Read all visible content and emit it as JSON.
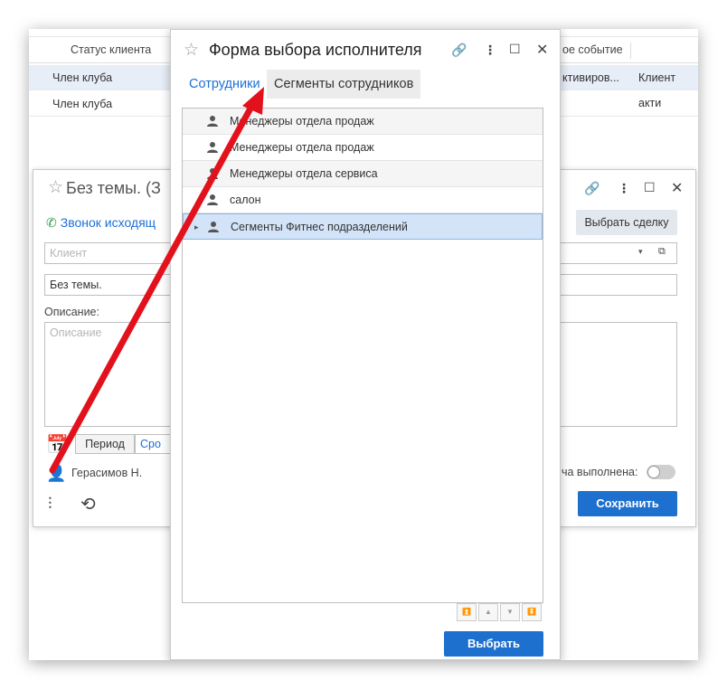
{
  "background_list": {
    "header": {
      "status_col": "Статус клиента",
      "event_col": "ое событие"
    },
    "rows": [
      {
        "status": "Член клуба",
        "event": "ктивиров...",
        "extra": "Клиент акти"
      },
      {
        "status": "Член клуба",
        "event": "",
        "extra": ""
      }
    ]
  },
  "task_form": {
    "title": "Без темы. (З",
    "call_link": "Звонок исходящ",
    "client_placeholder": "Клиент",
    "subject_value": "Без темы.",
    "description_label": "Описание:",
    "description_placeholder": "Описание",
    "period_button": "Период",
    "srok_tab": "Сро",
    "assignee": "Герасимов Н.",
    "done_label": "ча выполнена:",
    "select_deal_button": "Выбрать сделку",
    "save_button": "Сохранить"
  },
  "dialog": {
    "title": "Форма выбора исполнителя",
    "tabs": [
      "Сотрудники",
      "Сегменты сотрудников"
    ],
    "active_tab": "Сегменты сотрудников",
    "items": [
      {
        "label": "Менеджеры отдела продаж"
      },
      {
        "label": "Менеджеры отдела продаж"
      },
      {
        "label": "Менеджеры отдела сервиса"
      },
      {
        "label": "салон"
      },
      {
        "label": "Сегменты Фитнес подразделений",
        "selected": true
      }
    ],
    "select_button": "Выбрать"
  },
  "colors": {
    "accent": "#1e70cf",
    "selected_row": "#d3e4f8",
    "arrow": "#e3111b"
  }
}
